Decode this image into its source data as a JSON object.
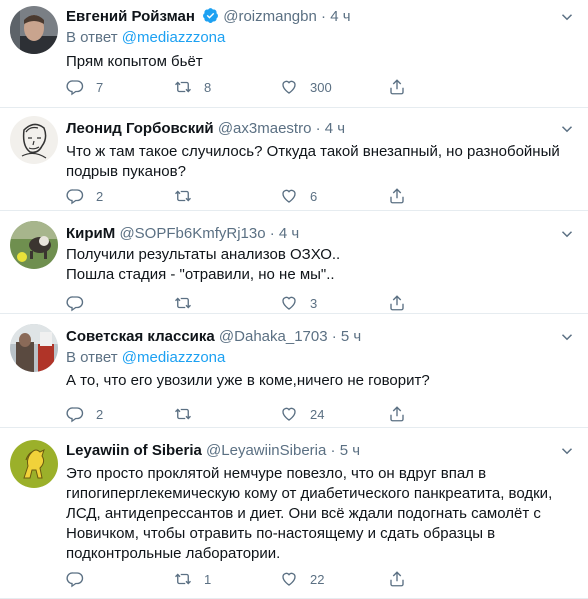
{
  "tweets": [
    {
      "name": "Евгений Ройзман",
      "verified": true,
      "handle": "@roizmangbn",
      "sep": "·",
      "time": "4 ч",
      "reply_label": "В ответ",
      "reply_to": "@mediazzzona",
      "lines": [
        "Прям копытом бьёт"
      ],
      "replies": "7",
      "retweets": "8",
      "likes": "300"
    },
    {
      "name": "Леонид Горбовский",
      "handle": "@ax3maestro",
      "sep": "·",
      "time": "4 ч",
      "lines": [
        "Что ж там такое случилось? Откуда такой внезапный, но  разнобойный",
        "подрыв пуканов?"
      ],
      "replies": "2",
      "retweets": "",
      "likes": "6"
    },
    {
      "name": "КириМ",
      "handle": "@SOPFb6KmfyRj13o",
      "sep": "·",
      "time": "4 ч",
      "lines": [
        "Получили результаты анализов ОЗХО..",
        "Пошла стадия - \"отравили, но не мы\".."
      ],
      "replies": "",
      "retweets": "",
      "likes": "3"
    },
    {
      "name": "Советская классика",
      "handle": "@Dahaka_1703",
      "sep": "·",
      "time": "5 ч",
      "reply_label": "В ответ",
      "reply_to": "@mediazzzona",
      "lines": [
        "А то, что его увозили уже в коме,ничего не говорит?"
      ],
      "replies": "2",
      "retweets": "",
      "likes": "24"
    },
    {
      "name": "Leyawiin of Siberia",
      "handle": "@LeyawiinSiberia",
      "sep": "·",
      "time": "5 ч",
      "lines": [
        "Это просто проклятой немчуре повезло, что он вдруг впал в",
        "гипогиперглекемическую кому от диабетического панкреатита, водки,",
        "ЛСД, антидепрессантов и диет. Они всё ждали подогнать самолёт с",
        "Новичком, чтобы отравить по-настоящему и сдать образцы в",
        "подконтрольные лаборатории."
      ],
      "replies": "",
      "retweets": "1",
      "likes": "22"
    }
  ]
}
